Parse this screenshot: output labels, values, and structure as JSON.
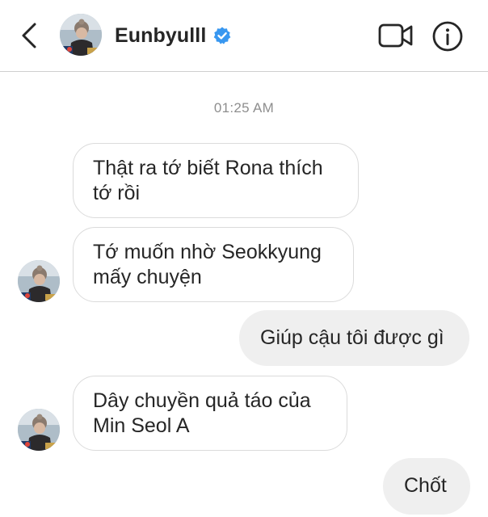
{
  "header": {
    "username": "Eunbyulll",
    "verified": true,
    "icons": {
      "back": "chevron-left-icon",
      "verified": "verified-badge-icon",
      "video": "video-camera-icon",
      "info": "info-icon"
    },
    "colors": {
      "verified_badge": "#3897f0"
    }
  },
  "conversation": {
    "timestamp": "01:25 AM",
    "messages": [
      {
        "sender": "them",
        "text": "Thật ra tớ biết Rona thích tớ rồi"
      },
      {
        "sender": "them",
        "text": "Tớ muốn nhờ Seokkyung mấy chuyện"
      },
      {
        "sender": "me",
        "text": "Giúp cậu tôi được gì"
      },
      {
        "sender": "them",
        "text": "Dây chuyền quả táo của Min Seol A"
      },
      {
        "sender": "me",
        "text": "Chốt"
      }
    ]
  },
  "colors": {
    "outgoing_bubble": "#efefef",
    "incoming_border": "#dbdbdb",
    "text": "#262626",
    "timestamp": "#8e8e8e"
  }
}
